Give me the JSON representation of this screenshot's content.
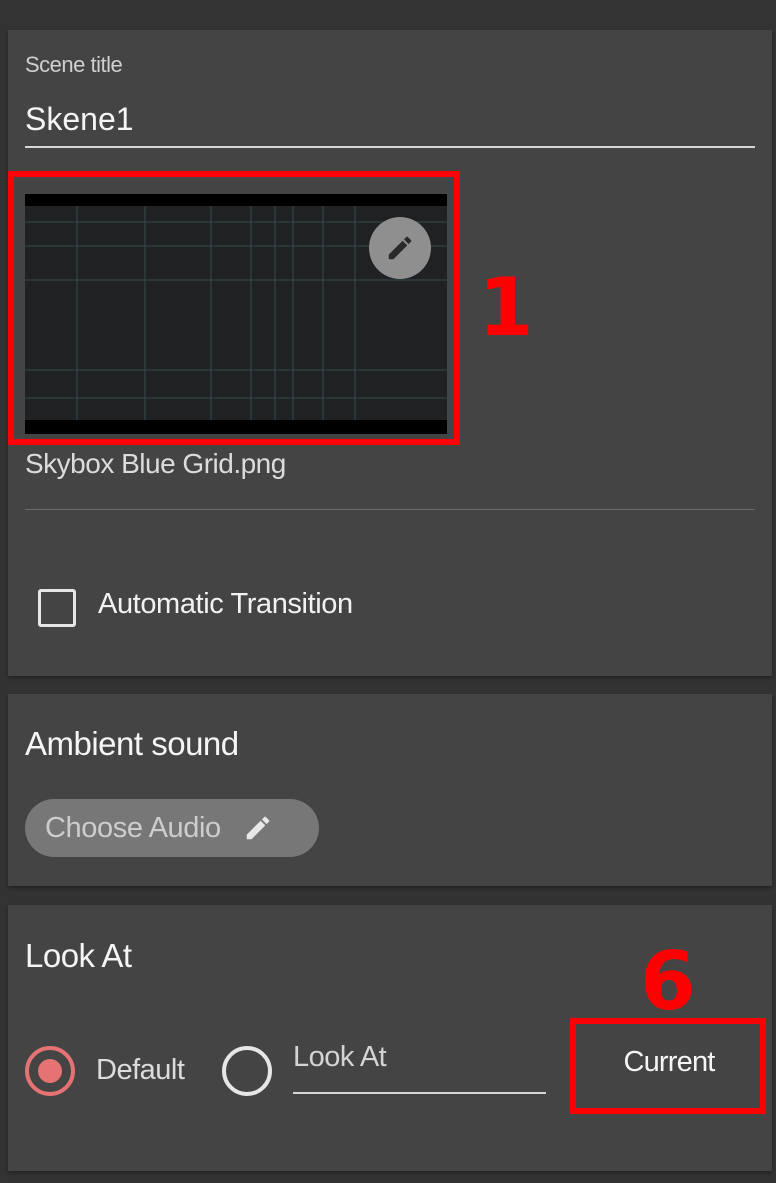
{
  "scene_panel": {
    "title_label": "Scene title",
    "title_value": "Skene1",
    "image_file": "Skybox Blue Grid.png",
    "edit_icon": "pencil-icon",
    "auto_transition_label": "Automatic Transition",
    "auto_transition_checked": false
  },
  "sound_panel": {
    "title": "Ambient sound",
    "choose_audio_label": "Choose Audio",
    "choose_audio_icon": "pencil-icon"
  },
  "look_panel": {
    "title": "Look At",
    "default_label": "Default",
    "selected": "Default",
    "look_at_placeholder": "Look At",
    "current_label": "Current"
  },
  "annotations": {
    "callout_1": "1",
    "callout_6": "6",
    "highlight_color": "#ff0000"
  },
  "colors": {
    "background": "#333333",
    "panel": "#444444",
    "accent_radio": "#e57373",
    "chip": "#777777"
  }
}
